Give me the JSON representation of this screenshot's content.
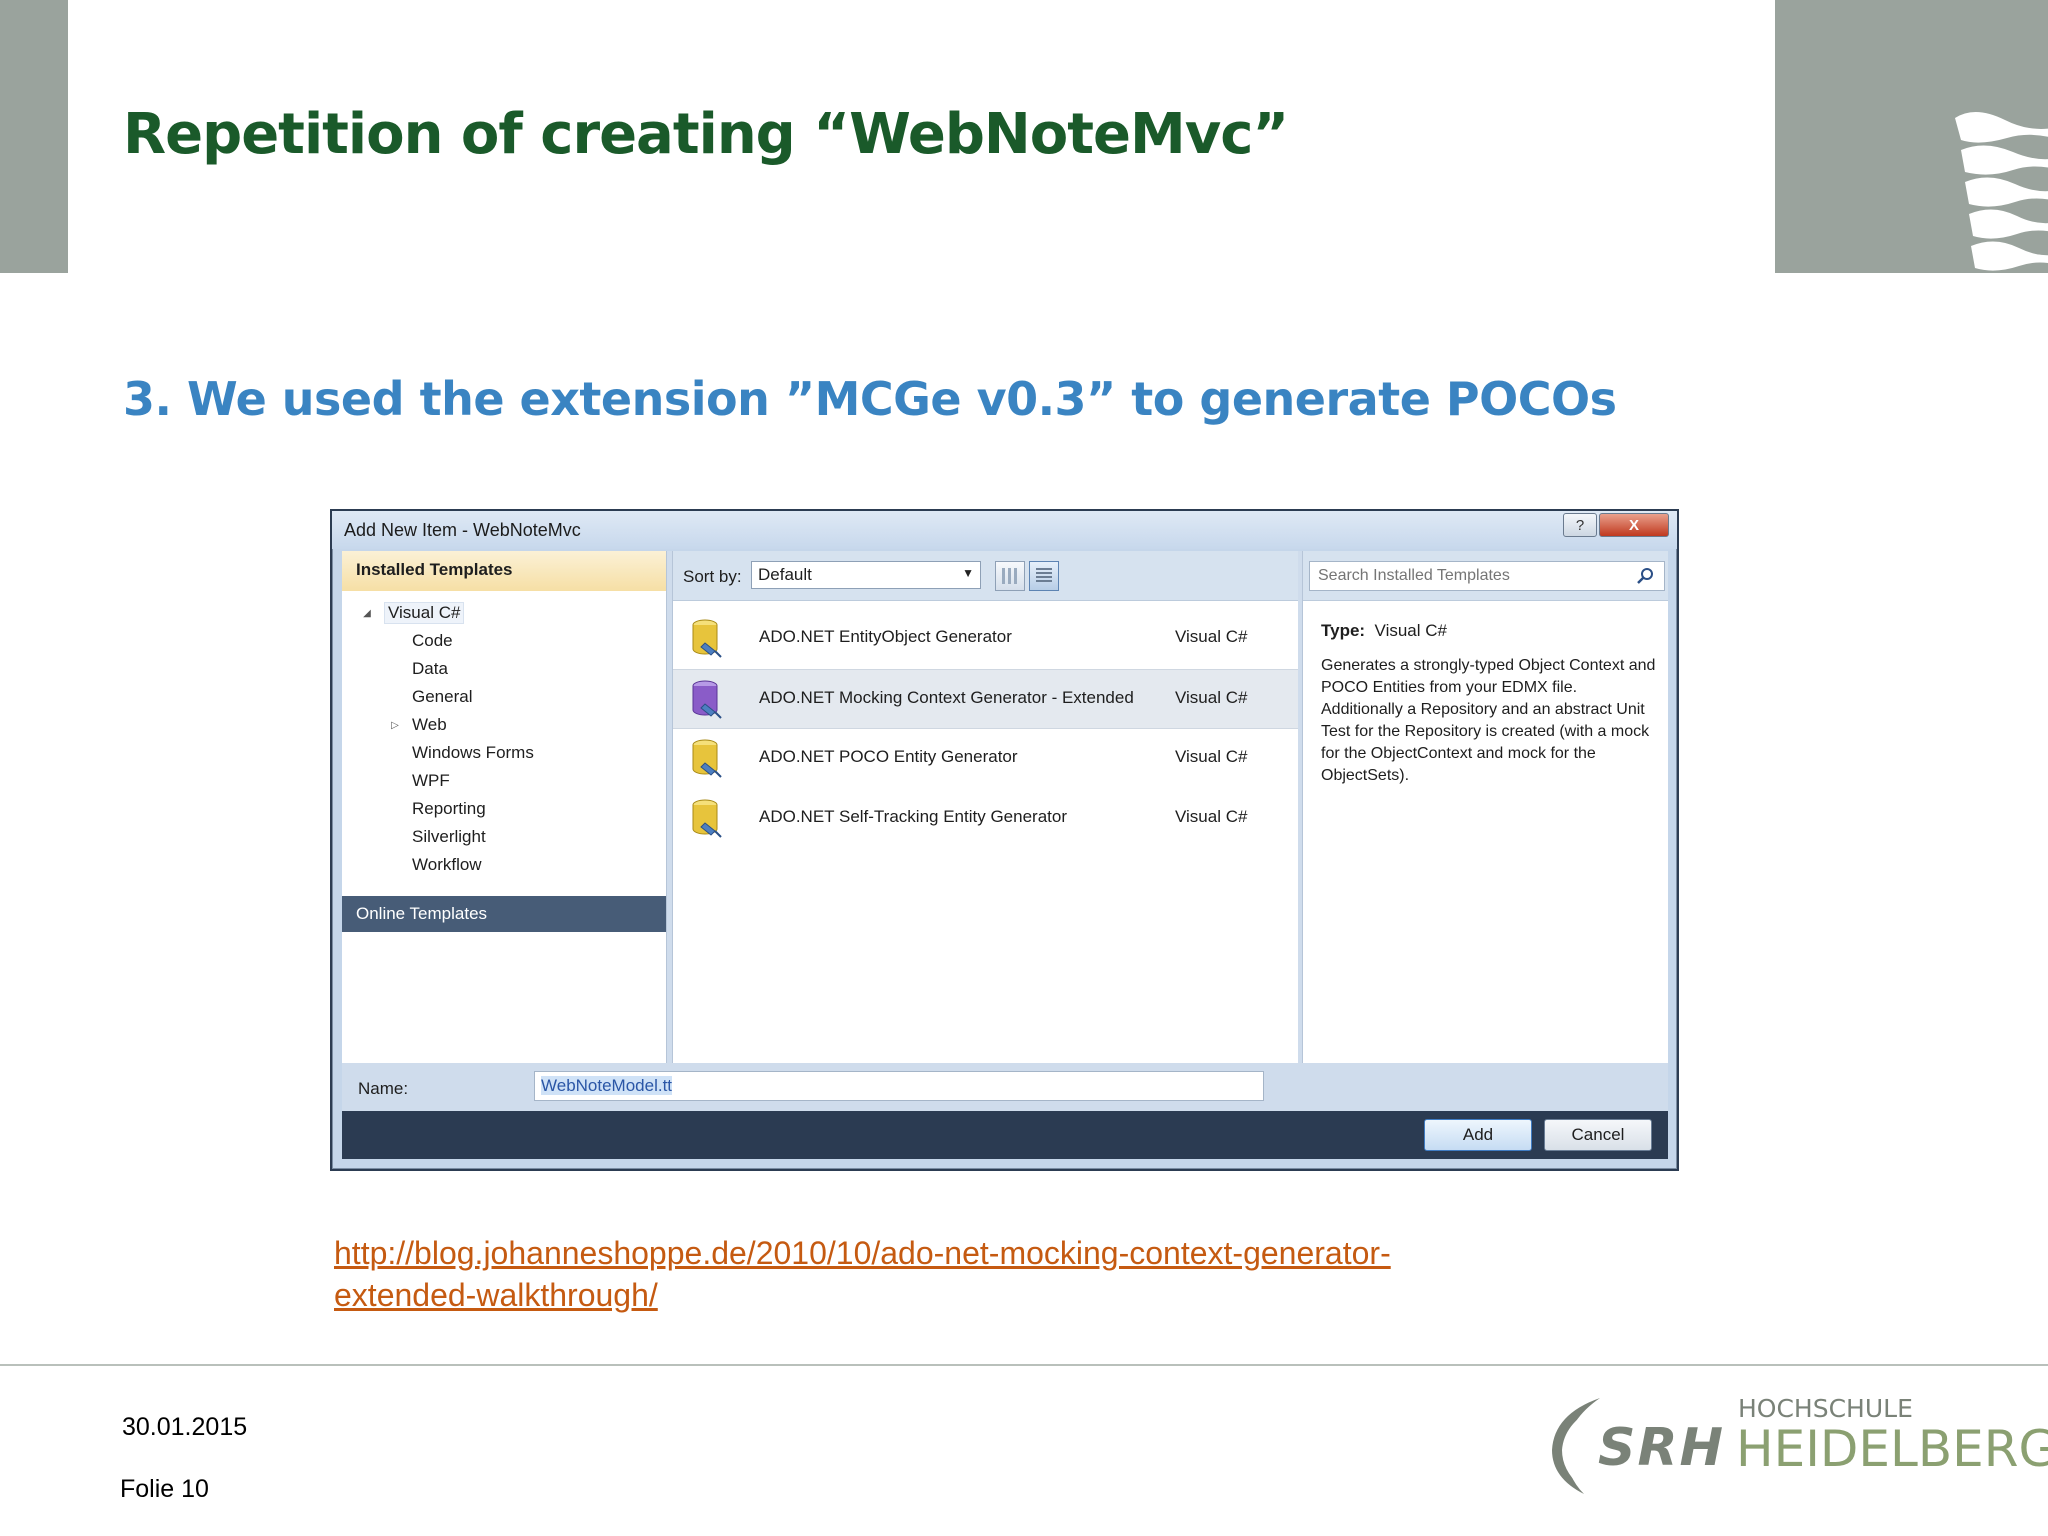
{
  "slide": {
    "title": "Repetition of creating “WebNoteMvc”",
    "subtitle": "3. We used the extension ”MCGe v0.3” to generate POCOs",
    "link_line1": "http://blog.johanneshoppe.de/2010/10/ado-net-mocking-context-generator-",
    "link_line2": "extended-walkthrough/",
    "date": "30.01.2015",
    "slide_number": "Folie 10"
  },
  "logo": {
    "brand": "SRH",
    "line1": "HOCHSCHULE",
    "line2": "HEIDELBERG"
  },
  "dialog": {
    "title": "Add New Item - WebNoteMvc",
    "help_glyph": "?",
    "close_glyph": "X",
    "installed_templates": "Installed Templates",
    "online_templates": "Online Templates",
    "tree": [
      {
        "label": "Visual C#",
        "expand": "◢"
      },
      {
        "label": "Code"
      },
      {
        "label": "Data"
      },
      {
        "label": "General"
      },
      {
        "label": "Web",
        "expand": "▷"
      },
      {
        "label": "Windows Forms"
      },
      {
        "label": "WPF"
      },
      {
        "label": "Reporting"
      },
      {
        "label": "Silverlight"
      },
      {
        "label": "Workflow"
      }
    ],
    "sort_label": "Sort by:",
    "sort_value": "Default",
    "search_placeholder": "Search Installed Templates",
    "templates": [
      {
        "name": "ADO.NET EntityObject Generator",
        "lang": "Visual C#",
        "icon": "database-yellow-icon",
        "color": "#e7c43c"
      },
      {
        "name": "ADO.NET Mocking Context Generator - Extended",
        "lang": "Visual C#",
        "icon": "database-purple-icon",
        "color": "#8a5cc8"
      },
      {
        "name": "ADO.NET POCO Entity Generator",
        "lang": "Visual C#",
        "icon": "database-yellow-icon",
        "color": "#e7c43c"
      },
      {
        "name": "ADO.NET Self-Tracking Entity Generator",
        "lang": "Visual C#",
        "icon": "database-yellow-icon",
        "color": "#e7c43c"
      }
    ],
    "type_label": "Type:",
    "type_value": "Visual C#",
    "description": "Generates a strongly-typed Object Context and POCO Entities from your EDMX file. Additionally a Repository and an abstract Unit Test for the Repository is created (with a mock for the ObjectContext and mock for the ObjectSets).",
    "name_label": "Name:",
    "name_value": "WebNoteModel.tt",
    "add_button": "Add",
    "cancel_button": "Cancel"
  },
  "colors": {
    "title_green": "#1a5a2a",
    "subtitle_blue": "#3a84c2",
    "link_orange": "#c55a11",
    "side_gray": "#9aa39d"
  }
}
